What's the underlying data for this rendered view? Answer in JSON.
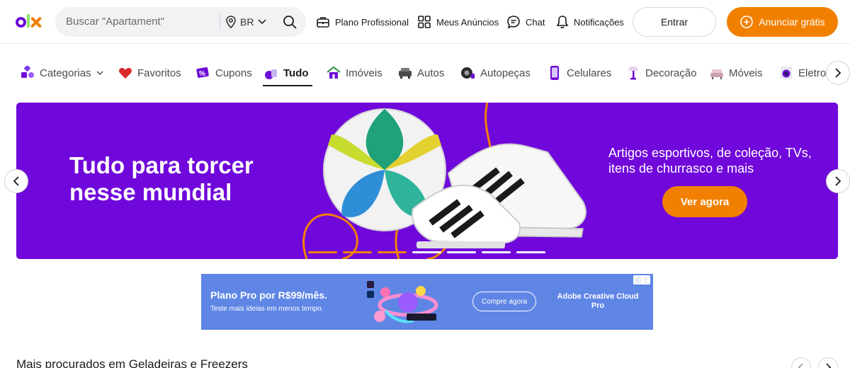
{
  "header": {
    "logo_text": "olx",
    "search": {
      "placeholder": "Buscar \"Apartament\"",
      "location": "BR"
    },
    "nav": [
      {
        "label": "Plano Profissional",
        "icon": "briefcase-icon"
      },
      {
        "label": "Meus Anúncios",
        "icon": "grid-icon"
      },
      {
        "label": "Chat",
        "icon": "chat-icon"
      },
      {
        "label": "Notificações",
        "icon": "bell-icon"
      }
    ],
    "login_label": "Entrar",
    "post_ad_label": "Anunciar grátis"
  },
  "categories": {
    "active_index": 3,
    "items": [
      {
        "label": "Categorias",
        "icon": "categories-icon"
      },
      {
        "label": "Favoritos",
        "icon": "heart-icon"
      },
      {
        "label": "Cupons",
        "icon": "coupon-icon"
      },
      {
        "label": "Tudo",
        "icon": "all-icon"
      },
      {
        "label": "Imóveis",
        "icon": "house-icon"
      },
      {
        "label": "Autos",
        "icon": "car-icon"
      },
      {
        "label": "Autopeças",
        "icon": "tire-icon"
      },
      {
        "label": "Celulares",
        "icon": "phone-icon"
      },
      {
        "label": "Decoração",
        "icon": "lamp-icon"
      },
      {
        "label": "Móveis",
        "icon": "sofa-icon"
      },
      {
        "label": "Eletro",
        "icon": "washer-icon"
      }
    ]
  },
  "banner": {
    "title": "Tudo para torcer nesse mundial",
    "subtitle": "Artigos esportivos, de coleção, TVs, itens de churrasco e mais",
    "cta": "Ver agora",
    "slides_total": 7,
    "active_slides": 3
  },
  "ad": {
    "title": "Plano Pro por R$99/mês.",
    "subtitle": "Teste mais ideias em menos tempo.",
    "cta": "Compre agora",
    "brand": "Adobe Creative Cloud Pro"
  },
  "section": {
    "title": "Mais procurados em Geladeiras e Freezers"
  },
  "colors": {
    "brand_purple": "#6e0ad6",
    "brand_orange": "#f28000",
    "brand_green": "#8ce563",
    "banner_bg": "#7007db",
    "ad_bg": "#5f86e5"
  }
}
